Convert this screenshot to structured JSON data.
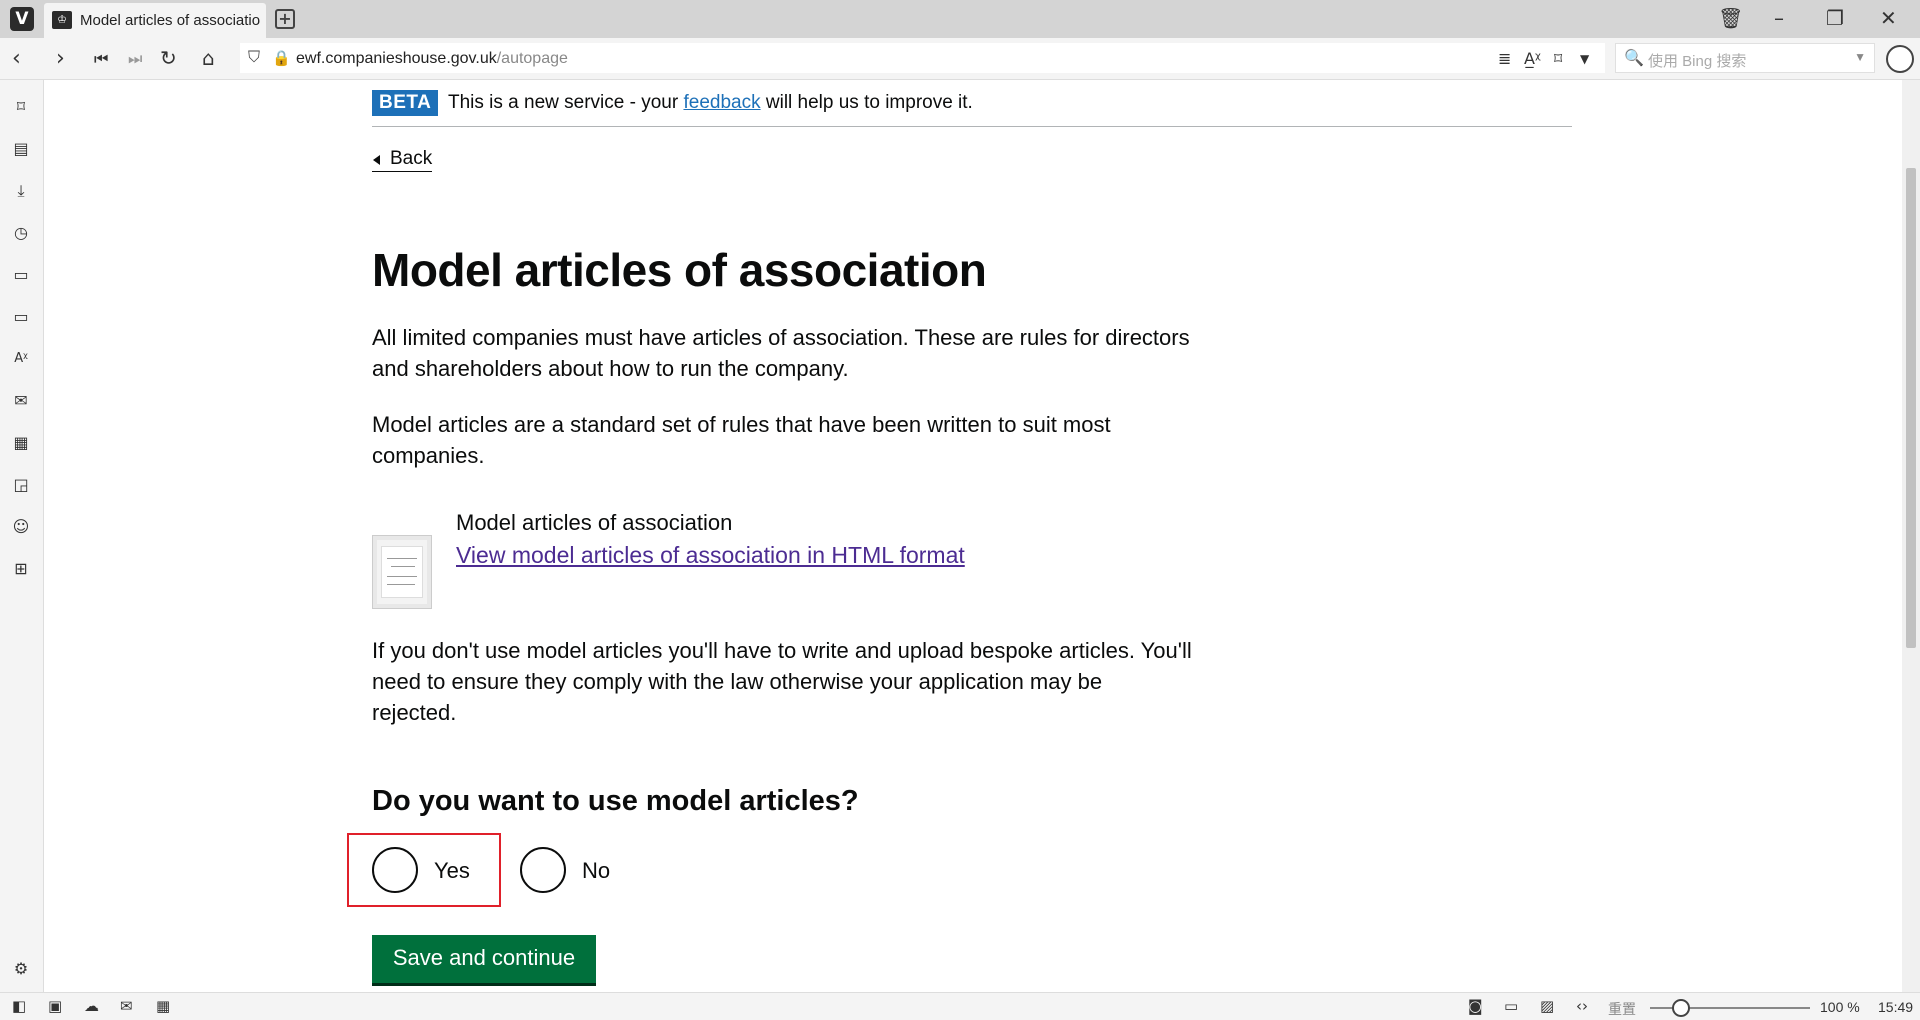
{
  "browser": {
    "tab_title": "Model articles of associatio",
    "url_host": "ewf.companieshouse.gov.uk",
    "url_path": "/autopage",
    "search_placeholder": "使用 Bing 搜索",
    "status_reset": "重置",
    "zoom_percent": "100 %",
    "clock": "15:49"
  },
  "page": {
    "beta_tag": "BETA",
    "beta_text_pre": "This is a new service - your ",
    "beta_link": "feedback",
    "beta_text_post": " will help us to improve it.",
    "back_label": "Back",
    "heading": "Model articles of association",
    "para1": "All limited companies must have articles of association. These are rules for directors and shareholders about how to run the company.",
    "para2": "Model articles are a standard set of rules that have been written to suit most companies.",
    "doc_title": "Model articles of association",
    "doc_link": "View model articles of association in HTML format",
    "para3": "If you don't use model articles you'll have to write and upload bespoke articles. You'll need to ensure they comply with the law otherwise your application may be rejected.",
    "question": "Do you want to use model articles?",
    "option_yes": "Yes",
    "option_no": "No",
    "submit_label": "Save and continue"
  },
  "colors": {
    "gov_blue": "#1d70b8",
    "gov_green": "#00703c",
    "visited_link": "#4c2c92",
    "highlight_red": "#e0202a"
  }
}
